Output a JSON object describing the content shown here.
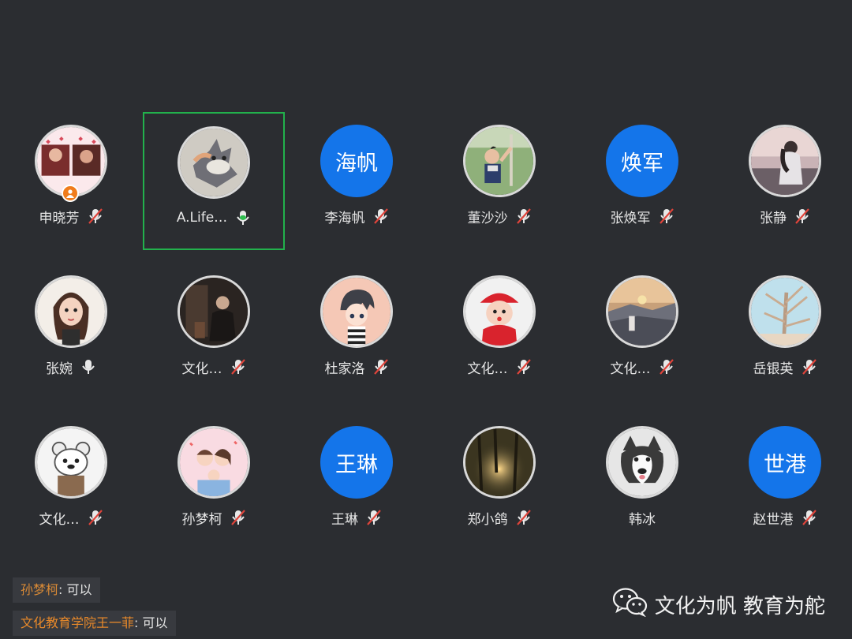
{
  "participants": [
    {
      "name": "申晓芳",
      "avatar_type": "photo",
      "avatar_desc": "couple-photo",
      "mic": "muted",
      "host": true,
      "active": false
    },
    {
      "name": "A.Life…",
      "avatar_type": "photo",
      "avatar_desc": "cartoon-wolf",
      "mic": "speaking",
      "host": false,
      "active": true
    },
    {
      "name": "李海帆",
      "avatar_type": "text",
      "avatar_text": "海帆",
      "mic": "muted",
      "host": false,
      "active": false
    },
    {
      "name": "董沙沙",
      "avatar_type": "photo",
      "avatar_desc": "child-outdoors",
      "mic": "muted",
      "host": false,
      "active": false
    },
    {
      "name": "张焕军",
      "avatar_type": "text",
      "avatar_text": "焕军",
      "mic": "muted",
      "host": false,
      "active": false
    },
    {
      "name": "张静",
      "avatar_type": "photo",
      "avatar_desc": "woman-sunset",
      "mic": "muted",
      "host": false,
      "active": false
    },
    {
      "name": "张婉",
      "avatar_type": "photo",
      "avatar_desc": "cartoon-girl",
      "mic": "on",
      "host": false,
      "active": false
    },
    {
      "name": "文化…",
      "avatar_type": "photo",
      "avatar_desc": "dark-photo",
      "mic": "muted",
      "host": false,
      "active": false
    },
    {
      "name": "杜家洛",
      "avatar_type": "photo",
      "avatar_desc": "anime-boy",
      "mic": "muted",
      "host": false,
      "active": false
    },
    {
      "name": "文化…",
      "avatar_type": "photo",
      "avatar_desc": "little-girl-red-hat",
      "mic": "muted",
      "host": false,
      "active": false
    },
    {
      "name": "文化…",
      "avatar_type": "photo",
      "avatar_desc": "sunset-mountain",
      "mic": "muted",
      "host": false,
      "active": false
    },
    {
      "name": "岳银英",
      "avatar_type": "photo",
      "avatar_desc": "winter-tree",
      "mic": "muted",
      "host": false,
      "active": false
    },
    {
      "name": "文化…",
      "avatar_type": "photo",
      "avatar_desc": "white-bear-cartoon",
      "mic": "muted",
      "host": false,
      "active": false
    },
    {
      "name": "孙梦柯",
      "avatar_type": "photo",
      "avatar_desc": "cartoon-family",
      "mic": "muted",
      "host": false,
      "active": false
    },
    {
      "name": "王琳",
      "avatar_type": "text",
      "avatar_text": "王琳",
      "mic": "muted",
      "host": false,
      "active": false
    },
    {
      "name": "郑小鸽",
      "avatar_type": "photo",
      "avatar_desc": "forest-light",
      "mic": "muted",
      "host": false,
      "active": false
    },
    {
      "name": "韩冰",
      "avatar_type": "photo",
      "avatar_desc": "husky-dog",
      "mic": "none",
      "host": false,
      "active": false
    },
    {
      "name": "赵世港",
      "avatar_type": "text",
      "avatar_text": "世港",
      "mic": "muted",
      "host": false,
      "active": false
    }
  ],
  "chat": [
    {
      "sender": "孙梦柯",
      "message": "可以"
    },
    {
      "sender": "文化教育学院王一菲",
      "message": "可以"
    }
  ],
  "watermark": {
    "text": "文化为帆 教育为舵",
    "icon": "wechat-icon"
  },
  "colors": {
    "background": "#2b2d31",
    "text_avatar": "#1475ea",
    "active_border": "#22b14c",
    "mic_muted_slash": "#e0443b",
    "mic_speaking": "#2fbe4f",
    "host_badge": "#f07c1b"
  }
}
